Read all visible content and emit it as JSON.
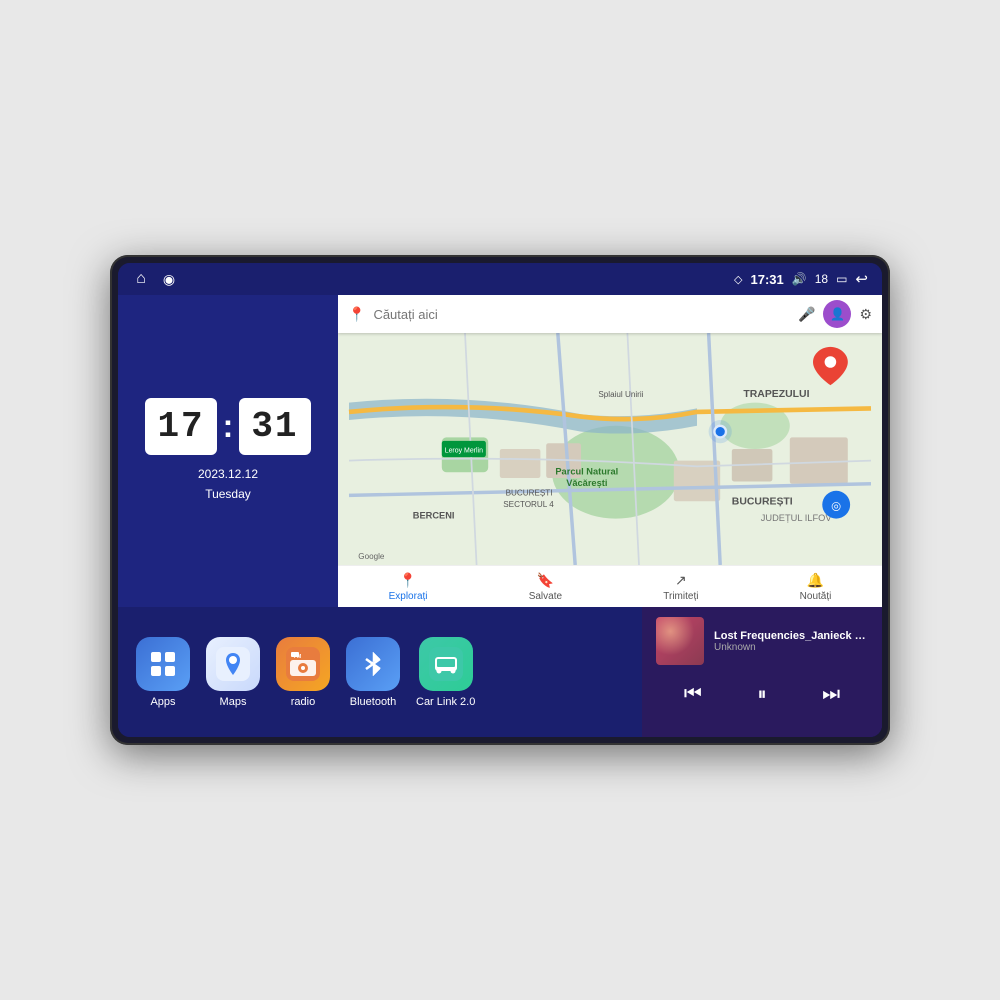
{
  "device": {
    "status_bar": {
      "gps_icon": "◇",
      "time": "17:31",
      "volume_icon": "🔊",
      "battery_level": "18",
      "battery_icon": "▭",
      "back_icon": "↩",
      "home_icon": "⌂",
      "nav2_icon": "◉"
    },
    "clock": {
      "hour": "17",
      "minute": "31",
      "date": "2023.12.12",
      "day": "Tuesday"
    },
    "map": {
      "search_placeholder": "Căutați aici",
      "tabs": [
        {
          "label": "Explorați",
          "active": true
        },
        {
          "label": "Salvate",
          "active": false
        },
        {
          "label": "Trimiteți",
          "active": false
        },
        {
          "label": "Noutăți",
          "active": false
        }
      ],
      "locations": [
        "Parcul Natural Văcărești",
        "Leroy Merlin",
        "BUCUREȘTI",
        "JUDEȚUL ILFOV",
        "TRAPEZULUI",
        "BERCENI",
        "BUCUREȘTI SECTORUL 4",
        "Splaiul Unirii"
      ]
    },
    "apps": [
      {
        "id": "apps",
        "label": "Apps",
        "icon": "⊞",
        "color_class": "apps-bg"
      },
      {
        "id": "maps",
        "label": "Maps",
        "icon": "📍",
        "color_class": "maps-bg"
      },
      {
        "id": "radio",
        "label": "radio",
        "icon": "📻",
        "color_class": "radio-bg"
      },
      {
        "id": "bluetooth",
        "label": "Bluetooth",
        "icon": "❋",
        "color_class": "bluetooth-bg"
      },
      {
        "id": "carlink",
        "label": "Car Link 2.0",
        "icon": "🚗",
        "color_class": "carlink-bg"
      }
    ],
    "music": {
      "title": "Lost Frequencies_Janieck Devy-...",
      "artist": "Unknown",
      "prev_icon": "⏮",
      "play_icon": "⏸",
      "next_icon": "⏭"
    }
  }
}
